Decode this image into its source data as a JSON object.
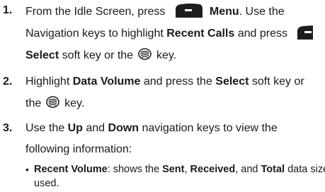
{
  "steps": [
    {
      "number": "1.",
      "line1_pre": "From the Idle Screen, press ",
      "line1_bold": "Menu",
      "line1_post": ". Use the",
      "line2_pre": "Navigation keys to highlight ",
      "line2_bold": "Recent Calls",
      "line2_post": " and press",
      "line3_bold": "Select",
      "line3_mid": " soft key or the ",
      "line3_post": " key."
    },
    {
      "number": "2.",
      "line1_pre": "Highlight ",
      "line1_bold": "Data Volume",
      "line1_mid": " and press the ",
      "line1_bold2": "Select",
      "line1_post": " soft key or",
      "line2_pre": "the ",
      "line2_post": " key."
    },
    {
      "number": "3.",
      "line1_pre": "Use the ",
      "line1_bold": "Up",
      "line1_mid": " and ",
      "line1_bold2": "Down",
      "line1_post": " navigation keys to view the",
      "line2": "following information:"
    }
  ],
  "bullet": {
    "bold1": "Recent Volume",
    "text1": ": shows the ",
    "bold2": "Sent",
    "text2": ", ",
    "bold3": "Received",
    "text3": ", and ",
    "bold4": "Total",
    "text4": " data size",
    "line2": "used."
  },
  "icons": {
    "softkey": "left-soft-key-icon",
    "navkey": "center-navigation-key-icon",
    "softkey_color": "#1e1e1e"
  }
}
